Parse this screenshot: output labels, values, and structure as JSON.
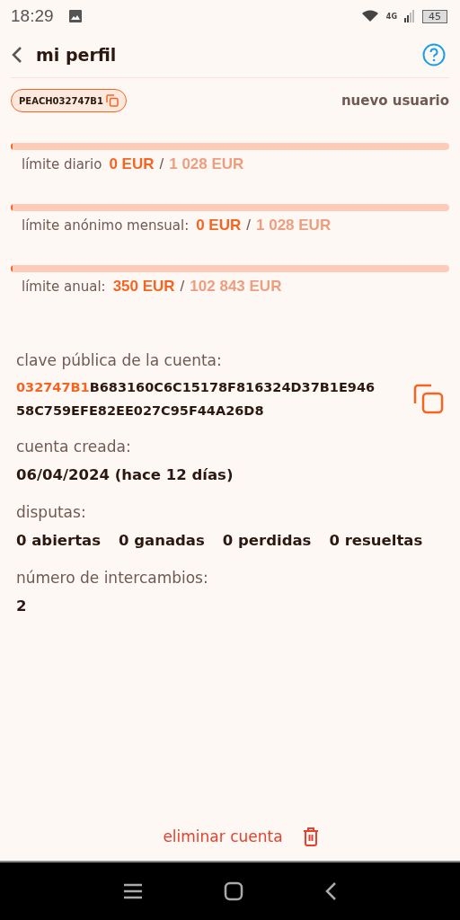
{
  "status_bar": {
    "time": "18:29",
    "network": "4G",
    "battery": "45"
  },
  "header": {
    "title": "mi perfil"
  },
  "user_id": {
    "label": "PEACH032747B1"
  },
  "user_status": "nuevo usuario",
  "limits": [
    {
      "label": "límite diario",
      "used": "0 EUR",
      "separator": "/",
      "max": "1 028 EUR",
      "level": 0
    },
    {
      "label": "límite anónimo mensual:",
      "used": "0 EUR",
      "separator": "/",
      "max": "1 028 EUR",
      "level": 0
    },
    {
      "label": "límite anual:",
      "used": "350 EUR",
      "separator": "/",
      "max": "102 843 EUR",
      "level": 0.003
    }
  ],
  "public_key": {
    "label": "clave pública de la cuenta:",
    "prefix": "032747B1",
    "lines": [
      "B683160C6C15178F816324D37B1E946",
      "58C759EFE82EE027C95F44A26D8"
    ]
  },
  "created": {
    "label": "cuenta creada:",
    "value": "06/04/2024 (hace 12 días)"
  },
  "disputes": {
    "label": "disputas:",
    "items": [
      "0 abiertas",
      "0 ganadas",
      "0 perdidas",
      "0 resueltas"
    ]
  },
  "trades": {
    "label": "número de intercambios:",
    "value": "2"
  },
  "delete_button": {
    "label": "eliminar cuenta"
  }
}
